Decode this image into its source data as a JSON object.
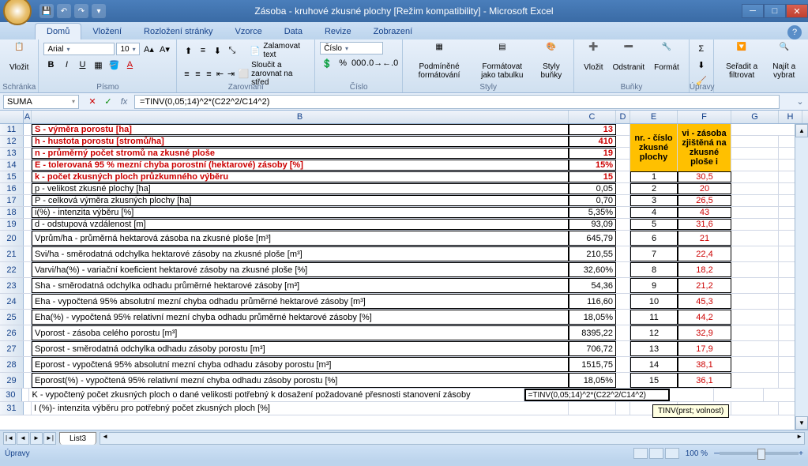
{
  "title": "Zásoba - kruhové zkusné plochy  [Režim kompatibility] - Microsoft Excel",
  "tabs": [
    "Domů",
    "Vložení",
    "Rozložení stránky",
    "Vzorce",
    "Data",
    "Revize",
    "Zobrazení"
  ],
  "active_tab": "Domů",
  "groups": {
    "clipboard": "Schránka",
    "font": "Písmo",
    "alignment": "Zarovnání",
    "number": "Číslo",
    "styles": "Styly",
    "cells": "Buňky",
    "editing": "Úpravy"
  },
  "ribbon": {
    "paste": "Vložit",
    "font_name": "Arial",
    "font_size": "10",
    "wrap": "Zalamovat text",
    "merge": "Sloučit a zarovnat na střed",
    "num_fmt": "Číslo",
    "cond_fmt": "Podmíněné formátování",
    "fmt_table": "Formátovat jako tabulku",
    "cell_styles": "Styly buňky",
    "insert": "Vložit",
    "delete": "Odstranit",
    "format": "Formát",
    "sort": "Seřadit a filtrovat",
    "find": "Najít a vybrat"
  },
  "name_box": "SUMA",
  "formula": "=TINV(0,05;14)^2*(C22^2/C14^2)",
  "cols": [
    "A",
    "B",
    "C",
    "D",
    "E",
    "F",
    "G",
    "H"
  ],
  "row_hdr_E1": "nr. - číslo zkusné plochy",
  "row_hdr_F1": "vi - zásoba zjištěná na zkusné ploše i",
  "rows": [
    {
      "n": 11,
      "b": "S - výměra porostu [ha]",
      "c": "13",
      "red": true
    },
    {
      "n": 12,
      "b": "h - hustota porostu [stromů/ha]",
      "c": "410",
      "red": true
    },
    {
      "n": 13,
      "b": "n - průměrný počet stromů na zkusné ploše",
      "c": "19",
      "red": true
    },
    {
      "n": 14,
      "b": "E - tolerovaná 95 % mezní chyba porostní (hektarové) zásoby [%]",
      "c": "15%",
      "red": true
    },
    {
      "n": 15,
      "b": "k - počet zkusných ploch průzkumného výběru",
      "c": "15",
      "red": true,
      "e": "1",
      "f": "30,5"
    },
    {
      "n": 16,
      "b": "p - velikost zkusné plochy [ha]",
      "c": "0,05",
      "e": "2",
      "f": "20"
    },
    {
      "n": 17,
      "b": "P - celková výměra zkusných plochy [ha]",
      "c": "0,70",
      "e": "3",
      "f": "26,5"
    },
    {
      "n": 18,
      "b": "i(%) - intenzita výběru [%]",
      "c": "5,35%",
      "e": "4",
      "f": "43"
    },
    {
      "n": 19,
      "b": "d - odstupová vzdálenost [m]",
      "c": "93,09",
      "e": "5",
      "f": "31,6"
    },
    {
      "n": 20,
      "b": "Vprům/ha - průměrná hektarová zásoba na zkusné ploše [m³]",
      "c": "645,79",
      "e": "6",
      "f": "21"
    },
    {
      "n": 21,
      "b": "Svi/ha - směrodatná odchylka hektarové zásoby na zkusné ploše [m³]",
      "c": "210,55",
      "e": "7",
      "f": "22,4"
    },
    {
      "n": 22,
      "b": "Varvi/ha(%) - variační koeficient hektarové zásoby na zkusné ploše [%]",
      "c": "32,60%",
      "e": "8",
      "f": "18,2"
    },
    {
      "n": 23,
      "b": "Sha - směrodatná odchylka odhadu průměrné hektarové zásoby [m³]",
      "c": "54,36",
      "e": "9",
      "f": "21,2"
    },
    {
      "n": 24,
      "b": "Eha - vypočtená 95% absolutní mezní chyba odhadu průměrné hektarové zásoby [m³]",
      "c": "116,60",
      "e": "10",
      "f": "45,3"
    },
    {
      "n": 25,
      "b": "Eha(%) - vypočtená 95% relativní mezní chyba odhadu průměrné hektarové zásoby [%]",
      "c": "18,05%",
      "e": "11",
      "f": "44,2"
    },
    {
      "n": 26,
      "b": "Vporost - zásoba celého porostu [m³]",
      "c": "8395,22",
      "e": "12",
      "f": "32,9"
    },
    {
      "n": 27,
      "b": "Sporost - směrodatná odchylka odhadu zásoby porostu [m³]",
      "c": "706,72",
      "e": "13",
      "f": "17,9"
    },
    {
      "n": 28,
      "b": "Eporost - vypočtená 95% absolutní mezní chyba odhadu zásoby porostu [m³]",
      "c": "1515,75",
      "e": "14",
      "f": "38,1"
    },
    {
      "n": 29,
      "b": "Eporost(%) - vypočtená 95% relativní mezní chyba odhadu zásoby porostu [%]",
      "c": "18,05%",
      "e": "15",
      "f": "36,1"
    },
    {
      "n": 30,
      "b": "K - vypočtený počet zkusných ploch o dané velikosti potřebný k dosažení požadované přesnosti stanovení zásoby",
      "c": "=TINV(0,05;14)^2*(C22^2/C14^2)",
      "edit": true
    },
    {
      "n": 31,
      "b": "I (%)- intenzita výběru pro potřebný počet zkusných ploch [%]"
    }
  ],
  "tooltip": "TINV(prst; volnost)",
  "sheet": "List3",
  "status": "Úpravy",
  "zoom": "100 %"
}
